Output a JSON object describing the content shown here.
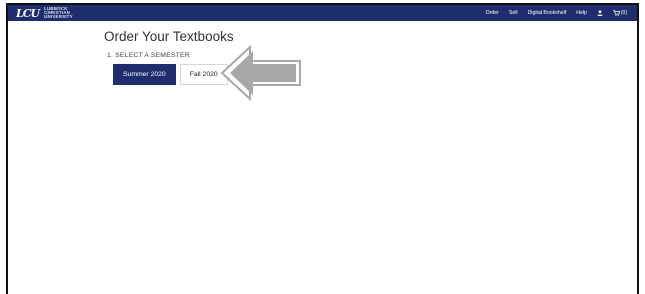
{
  "header": {
    "logo": {
      "line1": "LUBBOCK",
      "line2": "CHRISTIAN",
      "line3": "UNIVERSITY"
    },
    "nav": {
      "order": "Order",
      "sell": "Sell",
      "bookshelf": "Digital Bookshelf",
      "help": "Help",
      "account_icon": "user-icon",
      "cart_icon": "cart-icon",
      "cart_count": "(0)"
    },
    "bg_color": "#1f2d6e"
  },
  "main": {
    "title": "Order Your Textbooks",
    "step_label": "1. SELECT A SEMESTER",
    "semesters": [
      {
        "label": "Summer 2020",
        "selected": true
      },
      {
        "label": "Fall 2020",
        "selected": false
      }
    ]
  },
  "annotation": {
    "arrow_icon": "left-arrow-icon",
    "arrow_color": "#a8a8a8"
  },
  "colors": {
    "accent": "#1f2d6e"
  }
}
